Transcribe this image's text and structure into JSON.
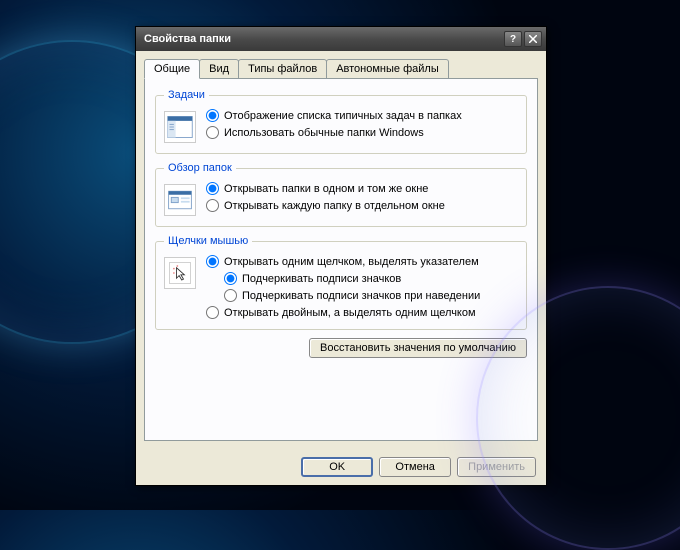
{
  "window": {
    "title": "Свойства папки"
  },
  "tabs": {
    "general": "Общие",
    "view": "Вид",
    "filetypes": "Типы файлов",
    "offline": "Автономные файлы"
  },
  "groups": {
    "tasks": {
      "legend": "Задачи",
      "opt_show_common": "Отображение списка типичных задач в папках",
      "opt_classic": "Использовать обычные папки Windows"
    },
    "browse": {
      "legend": "Обзор папок",
      "opt_same_window": "Открывать папки в одном и том же окне",
      "opt_new_window": "Открывать каждую папку в отдельном окне"
    },
    "click": {
      "legend": "Щелчки мышью",
      "opt_single": "Открывать одним щелчком, выделять указателем",
      "opt_underline_always": "Подчеркивать подписи значков",
      "opt_underline_hover": "Подчеркивать подписи значков при наведении",
      "opt_double": "Открывать двойным, а выделять одним щелчком"
    }
  },
  "buttons": {
    "restore": "Восстановить значения по умолчанию",
    "ok": "OK",
    "cancel": "Отмена",
    "apply": "Применить"
  }
}
